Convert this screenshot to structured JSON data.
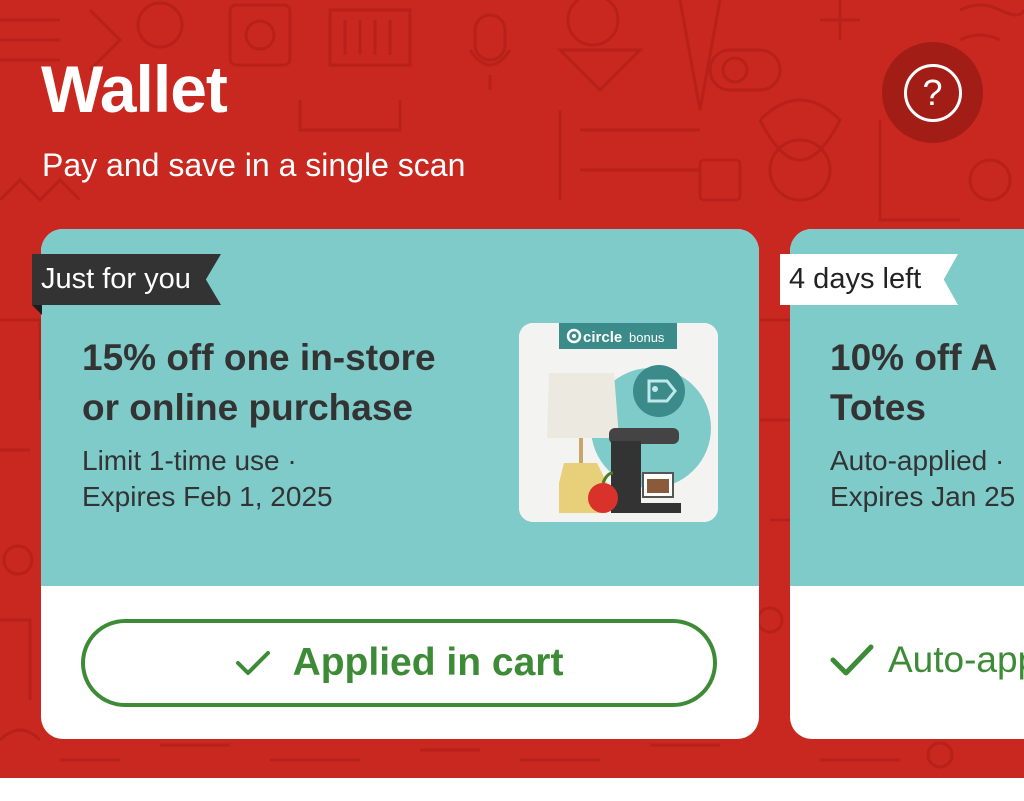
{
  "header": {
    "title": "Wallet",
    "subtitle": "Pay and save in a single scan",
    "help_icon": "question-circle-icon"
  },
  "offers": [
    {
      "tag": "Just for you",
      "title_line1": "15% off one in-store",
      "title_line2": "or online purchase",
      "desc_line1": "Limit 1-time use ·",
      "desc_line2": "Expires Feb 1, 2025",
      "badge_label": "circle",
      "badge_suffix": "bonus",
      "status_label": "Applied in cart",
      "status_icon": "checkmark-icon"
    },
    {
      "tag": "4 days left",
      "title_line1": "10% off A",
      "title_line2": "Totes",
      "desc_line1": "Auto-applied ·",
      "desc_line2": "Expires Jan 25",
      "status_label": "Auto-app",
      "status_icon": "checkmark-icon"
    }
  ],
  "colors": {
    "brand_red": "#c8281f",
    "card_teal": "#7ecbca",
    "success_green": "#3d8b37",
    "tag_dark": "#333333"
  }
}
